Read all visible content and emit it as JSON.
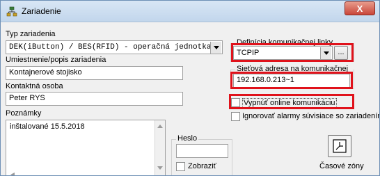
{
  "window": {
    "title": "Zariadenie",
    "close_label": "X"
  },
  "device_type": {
    "label": "Typ zariadenia",
    "value": "DEK(iButton) / BES(RFID) - operačná jednotka"
  },
  "description": {
    "label": "Umiestnenie/popis zariadenia",
    "value": "Kontajnerové stojisko"
  },
  "contact": {
    "label": "Kontaktná osoba",
    "value": "Peter RYS"
  },
  "notes": {
    "label": "Poznámky",
    "value": "inštalované 15.5.2018"
  },
  "link_definition": {
    "label": "Definícia komunikačnej linky",
    "value": "TCPIP",
    "browse_label": "..."
  },
  "network_address": {
    "label": "Sieťová adresa na komunikačnej linke",
    "value": "192.168.0.213~1"
  },
  "disable_online": {
    "label": "Vypnúť online komunikáciu",
    "checked": false
  },
  "ignore_alarms": {
    "label": "Ignorovať alarmy súvisiace so zariadením",
    "checked": false
  },
  "password": {
    "group_label": "Heslo",
    "value": "",
    "show_label": "Zobraziť",
    "show_checked": false
  },
  "time_zones": {
    "label": "Časové zóny"
  },
  "highlight_color": "#e0121b"
}
